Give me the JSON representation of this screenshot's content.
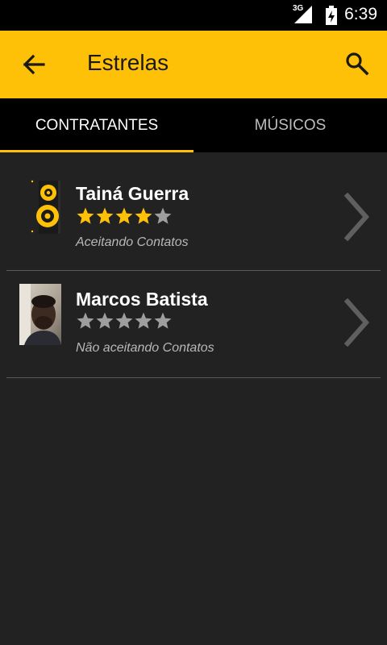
{
  "status_bar": {
    "network": "3G",
    "time": "6:39"
  },
  "app_bar": {
    "title": "Estrelas",
    "back_icon": "arrow-back-icon",
    "search_icon": "search-icon"
  },
  "tabs": [
    {
      "label": "CONTRATANTES",
      "active": true
    },
    {
      "label": "MÚSICOS",
      "active": false
    }
  ],
  "colors": {
    "accent": "#FFC107",
    "background": "#222222",
    "star_filled": "#FFC107",
    "star_empty": "#9e9e9e"
  },
  "list": {
    "items": [
      {
        "name": "Tainá Guerra",
        "rating": 4,
        "max_rating": 5,
        "status": "Aceitando Contatos",
        "avatar": "speaker-avatar"
      },
      {
        "name": "Marcos Batista",
        "rating": 0,
        "max_rating": 5,
        "status": "Não aceitando Contatos",
        "avatar": "person-photo-avatar"
      }
    ]
  }
}
